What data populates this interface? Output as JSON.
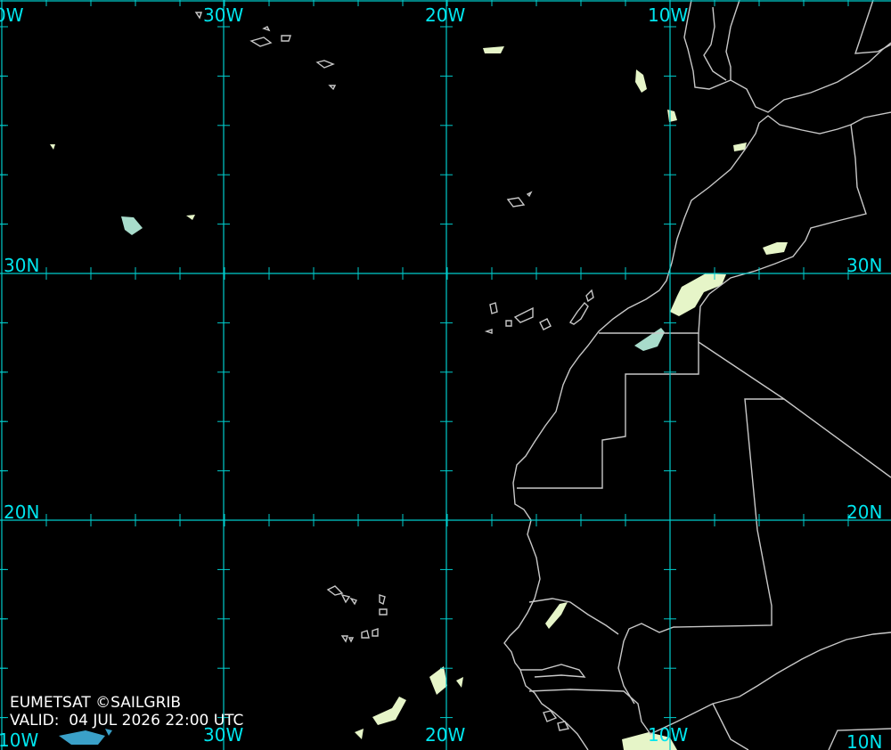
{
  "colors": {
    "background": "#000000",
    "gridline": "#00cccc",
    "grid_label": "#00e5ee",
    "coastline": "#c8c8c8",
    "cloud_light": "#e6f5c8",
    "cloud_mid": "#a8dccb",
    "cloud_cold": "#3aa0c8",
    "footer_text": "#ffffff"
  },
  "grid": {
    "longitude_labels": [
      "0W",
      "30W",
      "20W",
      "10W"
    ],
    "longitude_labels_bottom": [
      "10W",
      "30W",
      "20W",
      "10W"
    ],
    "latitude_labels": [
      "30N",
      "20N"
    ],
    "latitude_labels_right": [
      "30N",
      "20N"
    ],
    "right_bottom_corner_label": "10N"
  },
  "credits": {
    "source": "EUMETSAT ©SAILGRIB",
    "valid_prefix": "VALID:",
    "valid_time": "04 JUL 2026 22:00 UTC"
  }
}
